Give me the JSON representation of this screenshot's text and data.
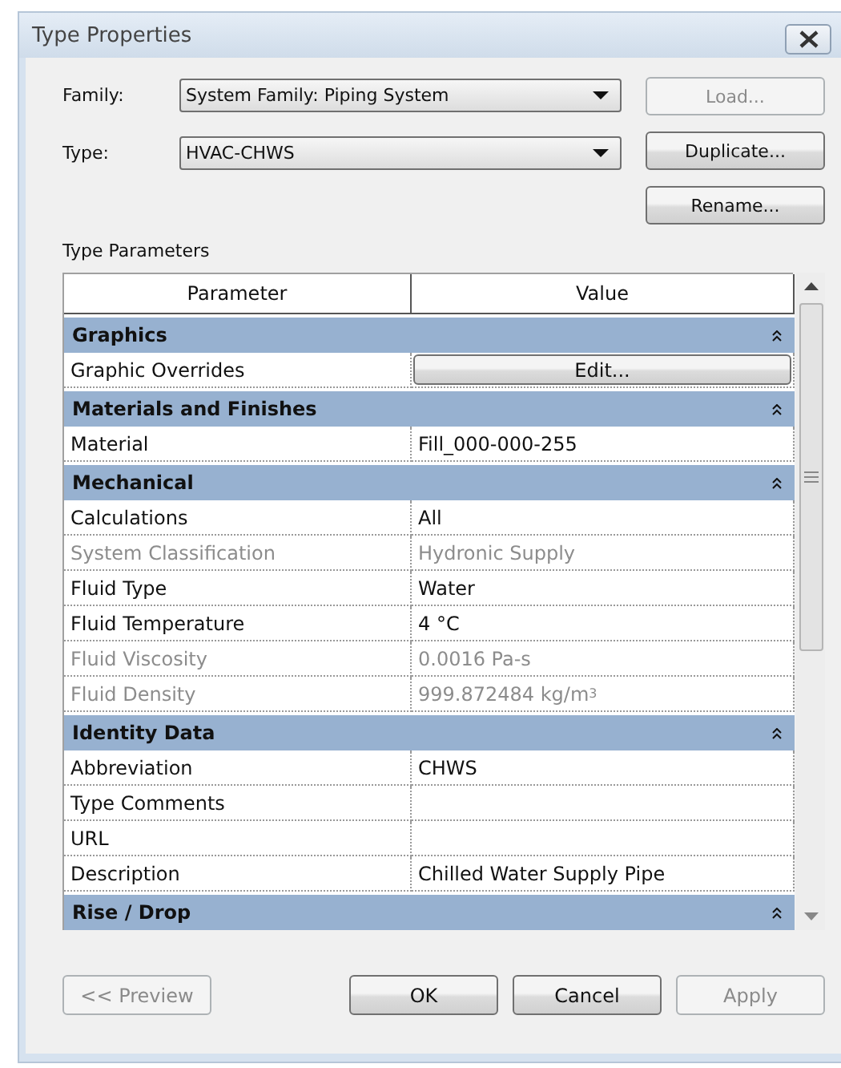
{
  "window": {
    "title": "Type Properties"
  },
  "fields": [
    {
      "label": "Family:",
      "value": "System Family: Piping System"
    },
    {
      "label": "Type:",
      "value": "HVAC-CHWS"
    }
  ],
  "side_buttons": [
    {
      "label": "Load...",
      "disabled": true
    },
    {
      "label": "Duplicate...",
      "disabled": false
    },
    {
      "label": "Rename...",
      "disabled": false
    }
  ],
  "section_title": "Type Parameters",
  "table": {
    "columns": [
      "Parameter",
      "Value"
    ],
    "rows": [
      {
        "kind": "group",
        "label": "Graphics",
        "expanded": true
      },
      {
        "kind": "button_param",
        "name": "Graphic Overrides",
        "value": "Edit...",
        "disabled": false
      },
      {
        "kind": "group",
        "label": "Materials and Finishes",
        "expanded": true
      },
      {
        "kind": "param",
        "name": "Material",
        "value": "Fill_000-000-255",
        "disabled": false
      },
      {
        "kind": "group",
        "label": "Mechanical",
        "expanded": true
      },
      {
        "kind": "param",
        "name": "Calculations",
        "value": "All",
        "disabled": false
      },
      {
        "kind": "param",
        "name": "System Classification",
        "value": "Hydronic Supply",
        "disabled": true
      },
      {
        "kind": "param",
        "name": "Fluid Type",
        "value": "Water",
        "disabled": false
      },
      {
        "kind": "param",
        "name": "Fluid Temperature",
        "value": "4 °C",
        "disabled": false
      },
      {
        "kind": "param",
        "name": "Fluid Viscosity",
        "value": "0.0016 Pa-s",
        "disabled": true
      },
      {
        "kind": "param",
        "name": "Fluid Density",
        "value": "999.872484 kg/m$^{3}$",
        "disabled": true
      },
      {
        "kind": "group",
        "label": "Identity Data",
        "expanded": true
      },
      {
        "kind": "param",
        "name": "Abbreviation",
        "value": "CHWS",
        "disabled": false
      },
      {
        "kind": "param",
        "name": "Type Comments",
        "disabled": false
      },
      {
        "kind": "param",
        "name": "URL",
        "disabled": false
      },
      {
        "kind": "param",
        "name": "Description",
        "value": "Chilled Water Supply Pipe",
        "disabled": false
      },
      {
        "kind": "group",
        "label": "Rise / Drop",
        "expanded": true
      }
    ]
  },
  "preview_button": {
    "label": "<< Preview",
    "disabled": true
  },
  "buttons": [
    {
      "label": "OK",
      "disabled": false
    },
    {
      "label": "Cancel",
      "disabled": false
    },
    {
      "label": "Apply",
      "disabled": true
    }
  ]
}
